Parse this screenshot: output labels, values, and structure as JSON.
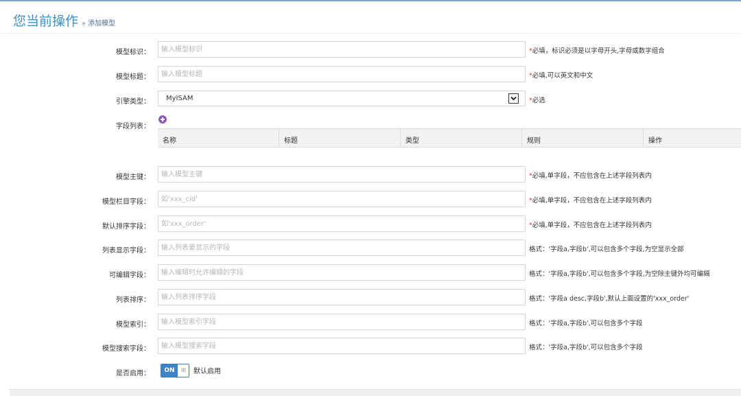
{
  "header": {
    "title": "您当前操作",
    "breadcrumb_sep": "»",
    "breadcrumb": "添加模型"
  },
  "fields": {
    "model_id": {
      "label": "模型标识：",
      "placeholder": "输入模型标识",
      "req_mark": "*",
      "hint": "必填，标识必须是以字母开头,字母或数字组合"
    },
    "model_title": {
      "label": "模型标题：",
      "placeholder": "输入模型标题",
      "req_mark": "*",
      "hint": "必填,可以英文和中文"
    },
    "engine": {
      "label": "引擎类型：",
      "value": "MyISAM",
      "req_mark": "*",
      "hint": "必选"
    },
    "field_list": {
      "label": "字段列表：",
      "add_icon": "plus-circle-icon",
      "columns": [
        "名称",
        "标题",
        "类型",
        "规则",
        "操作"
      ]
    },
    "primary_key": {
      "label": "模型主键：",
      "placeholder": "输入模型主键",
      "req_mark": "*",
      "hint": "必填,单字段，不应包含在上述字段列表内"
    },
    "column_field": {
      "label": "模型栏目字段：",
      "placeholder": "如'xxx_cid'",
      "req_mark": "*",
      "hint": "必填,单字段，不应包含在上述字段列表内"
    },
    "sort_field": {
      "label": "默认排序字段：",
      "placeholder": "如'xxx_order'",
      "req_mark": "*",
      "hint": "必填,单字段，不应包含在上述字段列表内"
    },
    "list_fields": {
      "label": "列表显示字段：",
      "placeholder": "输入列表要显示的字段",
      "hint": "格式：'字段a,字段b',可以包含多个字段,为空显示全部"
    },
    "editable_fields": {
      "label": "可编辑字段：",
      "placeholder": "输入编辑时允许编辑的字段",
      "hint": "格式：'字段a,字段b',可以包含多个字段,为空除主键外均可编辑"
    },
    "list_sort": {
      "label": "列表排序：",
      "placeholder": "输入列表排序字段",
      "hint": "格式：'字段a desc,字段b',默认上面设置的'xxx_order'"
    },
    "model_index": {
      "label": "模型索引：",
      "placeholder": "输入模型索引字段",
      "hint": "格式：'字段a,字段b',可以包含多个字段"
    },
    "search_fields": {
      "label": "模型搜索字段：",
      "placeholder": "输入模型搜索字段",
      "hint": "格式：'字段a,字段b',可以包含多个字段"
    },
    "enabled": {
      "label": "是否启用：",
      "switch_on": "ON",
      "knob": "III",
      "caption": "默认启用"
    }
  },
  "colors": {
    "title": "#3a8fc7",
    "required": "#d43a3a",
    "switch": "#3d83c7",
    "add_icon": "#8e5bb8"
  }
}
